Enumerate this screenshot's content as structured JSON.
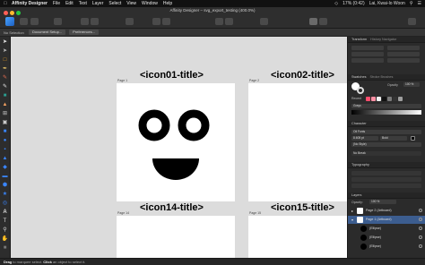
{
  "menubar": {
    "items": [
      "Affinity Designer",
      "File",
      "Edit",
      "Text",
      "Layer",
      "Select",
      "View",
      "Window",
      "Help"
    ],
    "battery": "17% (0:42)",
    "user": "Lai, Kwai-lo Woon"
  },
  "toolbar": {
    "document_title": "Affinity Designer – svg_export_testing (400.0%)"
  },
  "context_toolbar": {
    "selection_label": "No Selection",
    "document_setup_label": "Document Setup...",
    "preferences_label": "Preferences..."
  },
  "canvas": {
    "artboards": [
      {
        "label": "Page 1",
        "title": "<icon01-title>"
      },
      {
        "label": "Page 2",
        "title": "<icon02-title>"
      },
      {
        "label": "Page 14",
        "title": "<icon14-title>"
      },
      {
        "label": "Page 15",
        "title": "<icon15-title>"
      }
    ]
  },
  "panels": {
    "transform": {
      "title": "Transform",
      "tabs": "History   Navigator"
    },
    "swatches": {
      "title": "Swatches",
      "tabs": "Stroke   Brushes",
      "opacity_label": "Opacity",
      "opacity_value": "100 %",
      "recent_label": "Recent",
      "palette_label": "Grays",
      "colors": [
        "#ff4d6d",
        "#ff8fa3",
        "#f0f0f0",
        "#111111",
        "#7a7a7a",
        "#333333",
        "#9e9e9e"
      ]
    },
    "character": {
      "title": "Character",
      "font_value": "Oil Fonts",
      "size_value": "8.605 pt",
      "weight_value": "Bold",
      "style_value": "(No Style)",
      "no_break_label": "No Break"
    },
    "typography": {
      "title": "Typography"
    },
    "layers": {
      "title": "Layers",
      "opacity_label": "Opacity:",
      "opacity_value": "100 %",
      "items": [
        "Page 2 (Artboard)",
        "Page 1 (Artboard)",
        "(Ellipse)",
        "(Ellipse)",
        "(Ellipse)"
      ]
    }
  },
  "status": {
    "bold1": "Drag",
    "text1": " to marquee select. ",
    "bold2": "Click",
    "text2": " an object to select it."
  }
}
